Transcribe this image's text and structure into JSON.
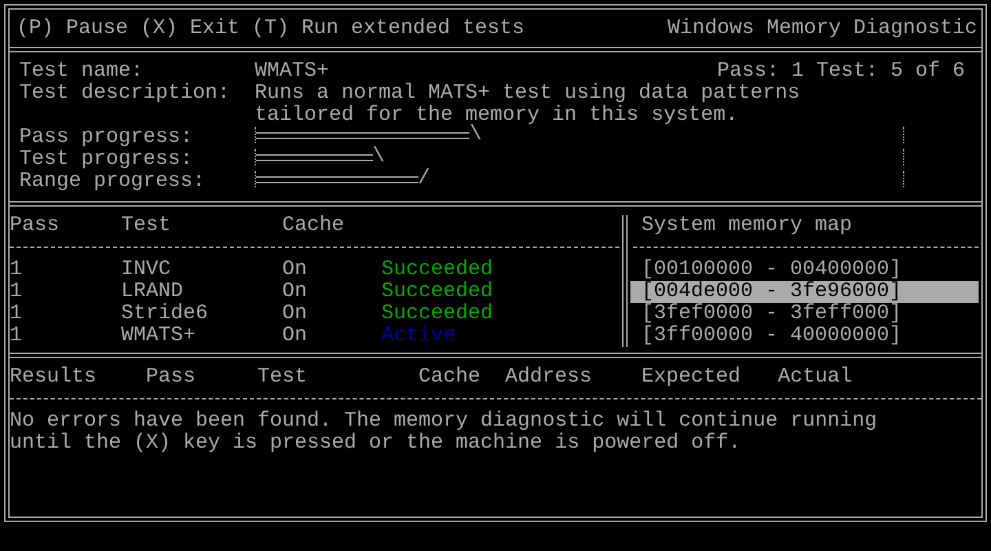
{
  "top_bar": {
    "commands": "(P) Pause (X) Exit (T) Run extended tests",
    "title": "Windows Memory Diagnostic"
  },
  "test_info": {
    "name_label": "Test name:",
    "name": "WMATS+",
    "position": "Pass: 1 Test: 5 of 6",
    "description_label": "Test description:",
    "description": [
      "Runs a normal MATS+ test using data patterns",
      "tailored for the memory in this system."
    ],
    "progress": [
      {
        "label": "Pass progress:",
        "level": 0.33,
        "spinner": "\\"
      },
      {
        "label": "Test progress:",
        "level": 0.18,
        "spinner": "\\"
      },
      {
        "label": "Range progress:",
        "level": 0.25,
        "spinner": "/"
      }
    ]
  },
  "tests_table": {
    "columns": [
      "Pass",
      "Test",
      "Cache"
    ],
    "rows": [
      {
        "pass": "1",
        "test": "INVC",
        "cache": "On",
        "status": "Succeeded",
        "color": "#00aa00"
      },
      {
        "pass": "1",
        "test": "LRAND",
        "cache": "On",
        "status": "Succeeded",
        "color": "#00aa00"
      },
      {
        "pass": "1",
        "test": "Stride6",
        "cache": "On",
        "status": "Succeeded",
        "color": "#00aa00"
      },
      {
        "pass": "1",
        "test": "WMATS+",
        "cache": "On",
        "status": "Active",
        "color": "#0000aa"
      }
    ]
  },
  "memory_map": {
    "title": "System memory map",
    "ranges": [
      {
        "text": "[00100000 - 00400000]",
        "selected": false
      },
      {
        "text": "[004de000 - 3fe96000]",
        "selected": true
      },
      {
        "text": "[3fef0000 - 3feff000]",
        "selected": false
      },
      {
        "text": "[3ff00000 - 40000000]",
        "selected": false
      }
    ]
  },
  "results": {
    "columns": [
      "Results",
      "Pass",
      "Test",
      "Cache",
      "Address",
      "Expected",
      "Actual"
    ],
    "message": [
      "No errors have been found. The memory diagnostic will continue running",
      "until the (X) key is pressed or the machine is powered off."
    ]
  }
}
